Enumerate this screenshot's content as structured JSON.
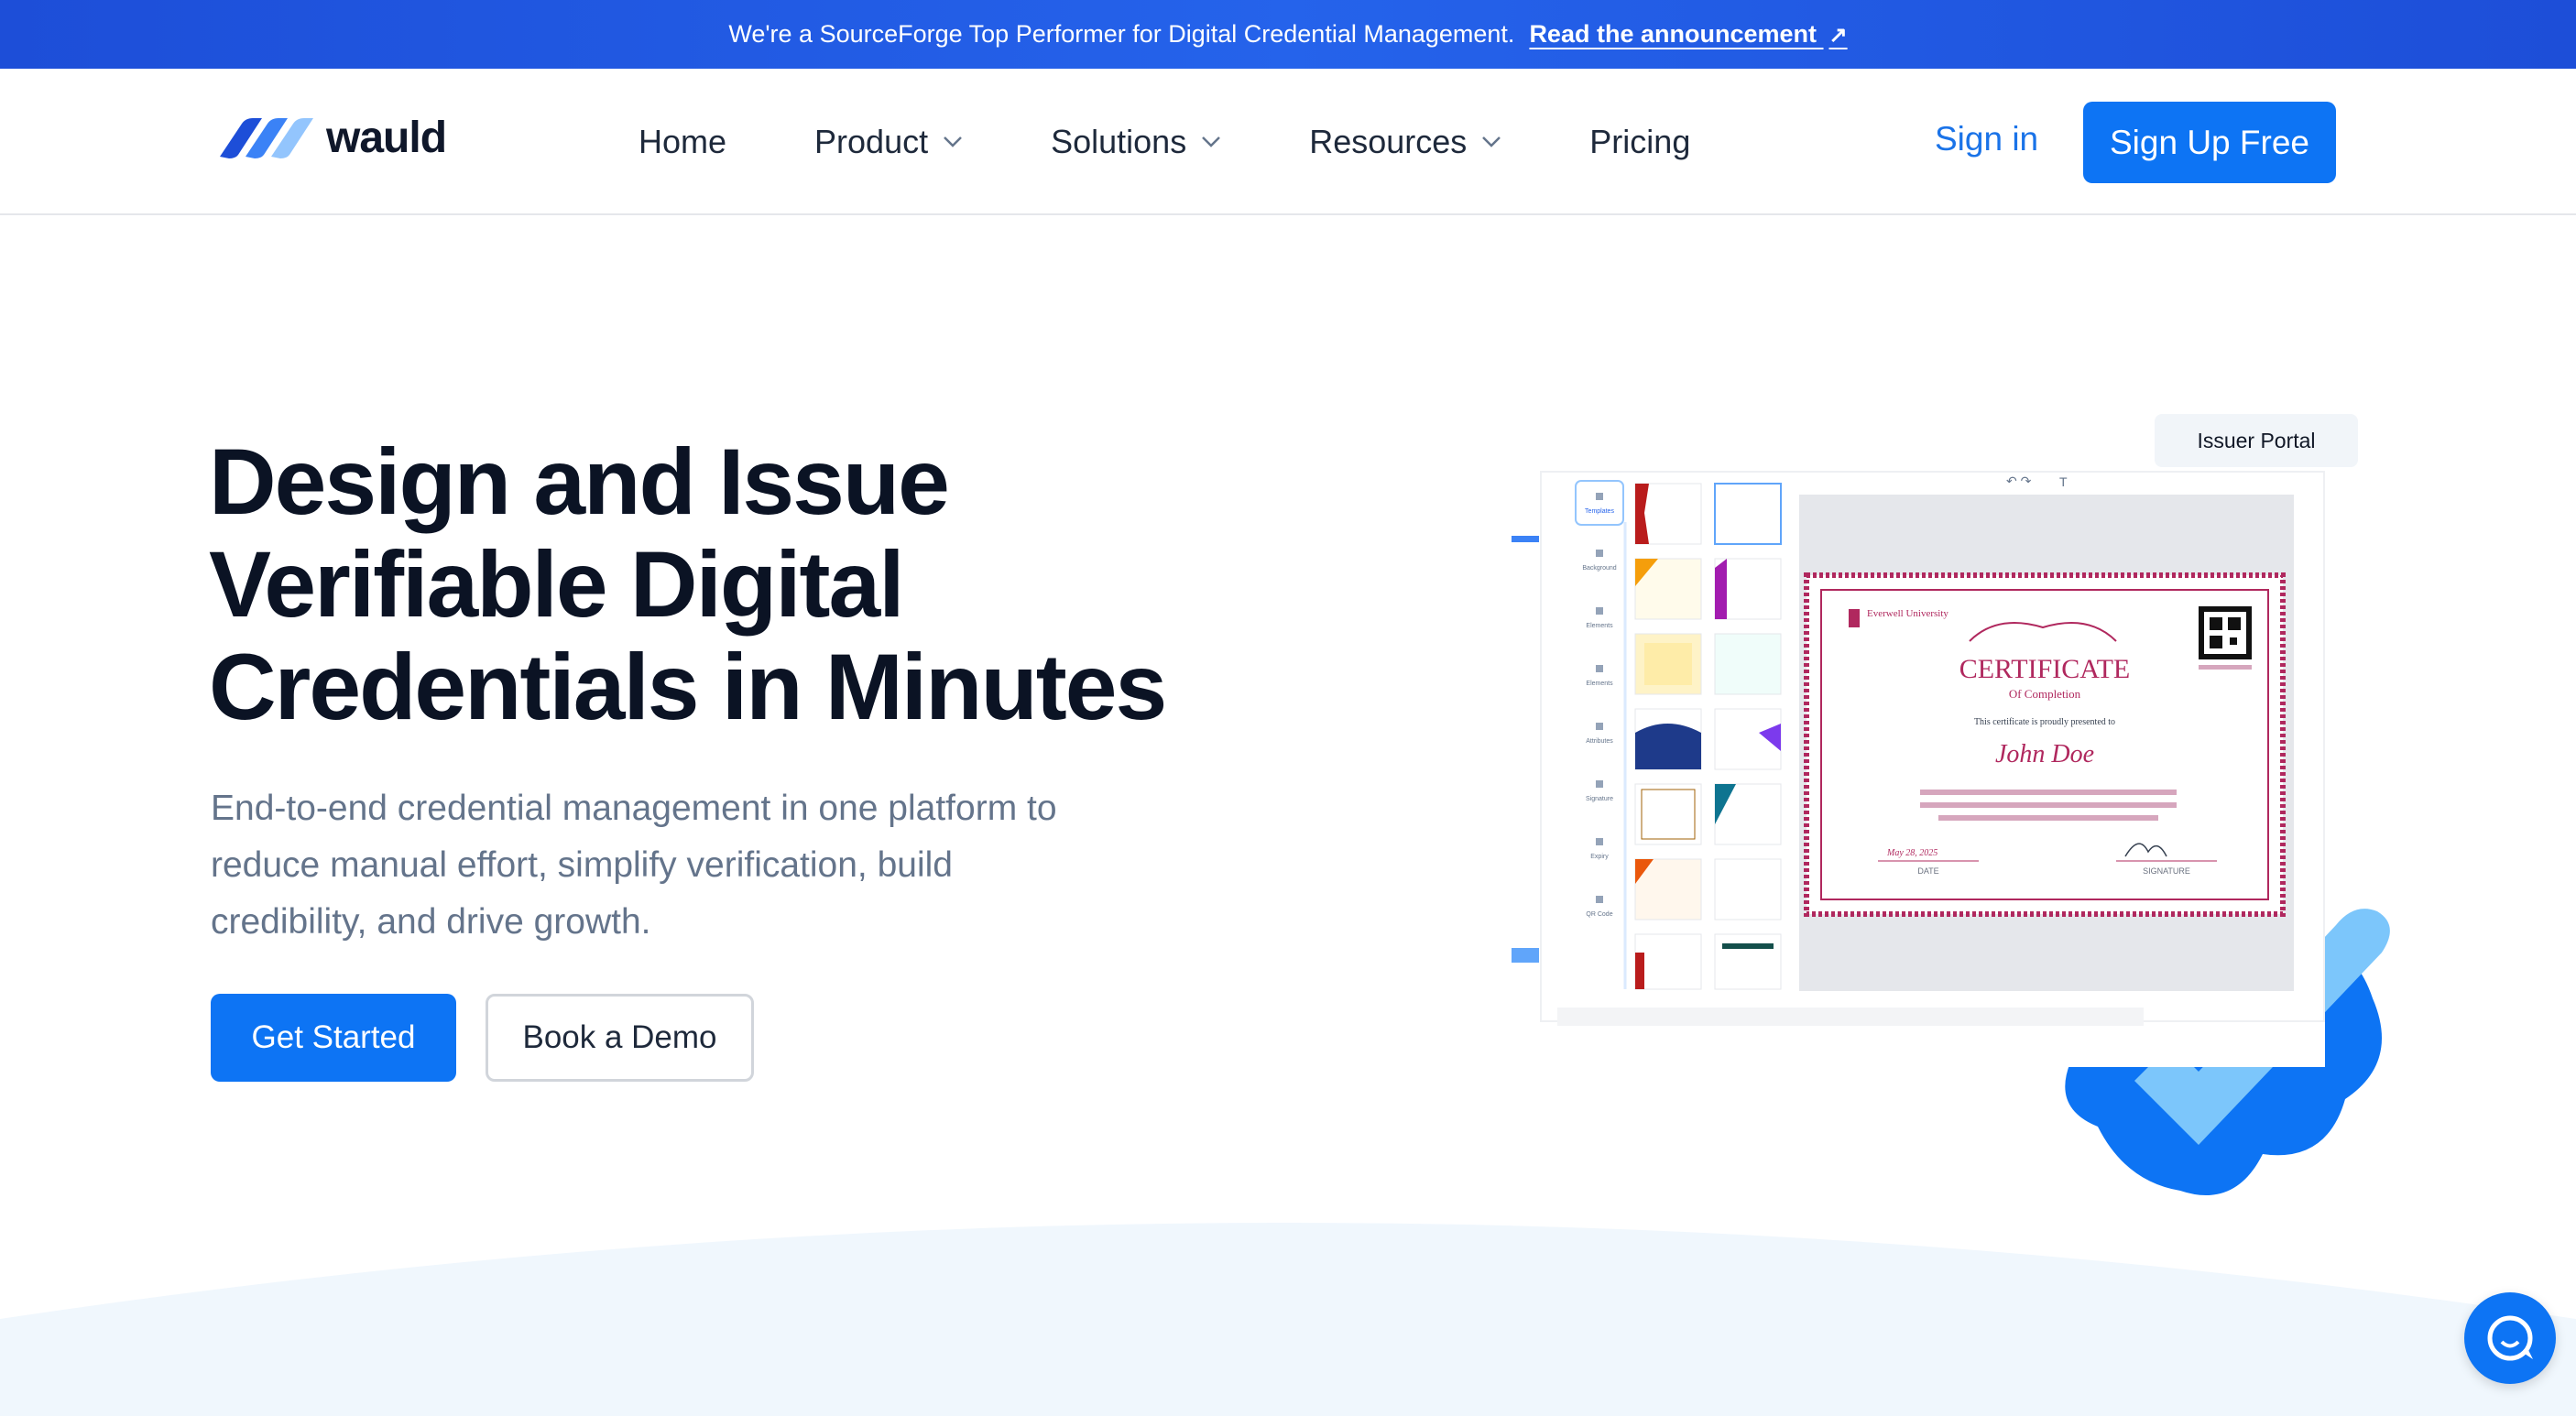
{
  "announcement": {
    "text": "We're a SourceForge Top Performer for Digital Credential Management.",
    "link_label": "Read the announcement",
    "arrow": "↗"
  },
  "brand": {
    "name": "wauld",
    "logo_icon": "wauld-logo-icon"
  },
  "nav": {
    "items": [
      {
        "label": "Home",
        "has_dropdown": false
      },
      {
        "label": "Product",
        "has_dropdown": true
      },
      {
        "label": "Solutions",
        "has_dropdown": true
      },
      {
        "label": "Resources",
        "has_dropdown": true
      },
      {
        "label": "Pricing",
        "has_dropdown": false
      }
    ],
    "signin_label": "Sign in",
    "signup_label": "Sign Up Free"
  },
  "hero": {
    "title_lines": [
      "Design and Issue",
      "Verifiable Digital",
      "Credentials in Minutes"
    ],
    "subtitle_lines": [
      "End-to-end credential management in one platform to",
      "reduce manual effort, simplify verification, build",
      "credibility, and drive growth."
    ],
    "primary_cta": "Get Started",
    "secondary_cta": "Book a Demo"
  },
  "illustration": {
    "portal_tag": "Issuer Portal",
    "sidebar_items": [
      "Templates",
      "Background",
      "Elements",
      "Elements",
      "Attributes",
      "Signature",
      "Expiry",
      "QR Code"
    ],
    "certificate": {
      "org": "Everwell University",
      "title": "CERTIFICATE",
      "subtitle": "Of Completion",
      "presented": "This certificate is proudly presented to",
      "name": "John Doe",
      "date_value": "May 28, 2025",
      "date_label": "DATE",
      "signature_label": "SIGNATURE"
    },
    "toolbar_text": "T"
  },
  "colors": {
    "primary": "#0d74f4",
    "announce_bg": "#1d4ed8",
    "title": "#0b1324",
    "subtitle": "#64748b",
    "certificate_accent": "#b0285e",
    "wave": "#f0f7fd"
  },
  "chat": {
    "icon": "chat-bubble-icon"
  }
}
